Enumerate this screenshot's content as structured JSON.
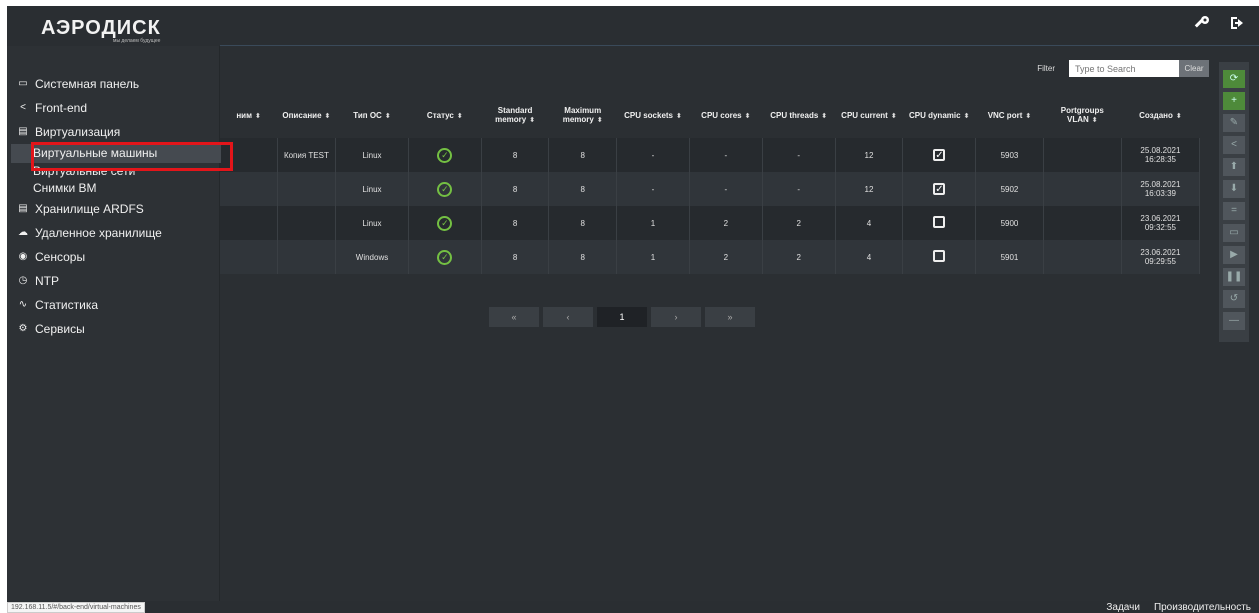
{
  "logo": {
    "text": "АЭРОДИСК",
    "sub": "мы делаем будущее"
  },
  "topbar": {
    "icons": [
      "key-icon",
      "logout-icon"
    ]
  },
  "sidebar": {
    "items": [
      {
        "label": "Системная панель",
        "icon": "monitor-icon"
      },
      {
        "label": "Front-end",
        "icon": "share-icon"
      },
      {
        "label": "Виртуализация",
        "icon": "database-icon"
      },
      {
        "label": "Виртуальные машины",
        "sub": true,
        "active": true
      },
      {
        "label": "Виртуальные сети",
        "sub": true
      },
      {
        "label": "Снимки ВМ",
        "sub": true
      },
      {
        "label": "Хранилище ARDFS",
        "icon": "database-icon"
      },
      {
        "label": "Удаленное хранилище",
        "icon": "cloud-icon"
      },
      {
        "label": "Сенсоры",
        "icon": "eye-icon"
      },
      {
        "label": "NTP",
        "icon": "clock-icon"
      },
      {
        "label": "Статистика",
        "icon": "chart-icon"
      },
      {
        "label": "Сервисы",
        "icon": "gears-icon"
      }
    ]
  },
  "filter": {
    "label": "Filter",
    "placeholder": "Type to Search",
    "clear": "Clear"
  },
  "table": {
    "headers": [
      "ним",
      "Описание",
      "Тип ОС",
      "Статус",
      "Standard memory",
      "Maximum memory",
      "CPU sockets",
      "CPU cores",
      "CPU threads",
      "CPU current",
      "CPU dynamic",
      "VNC port",
      "Portgroups VLAN",
      "Создано"
    ],
    "rows": [
      {
        "desc": "Копия TEST",
        "os": "Linux",
        "std": "8",
        "max": "8",
        "sockets": "-",
        "cores": "-",
        "threads": "-",
        "current": "12",
        "dynamic": true,
        "vnc": "5903",
        "vlan": "",
        "created_date": "25.08.2021",
        "created_time": "16:28:35"
      },
      {
        "desc": "",
        "os": "Linux",
        "std": "8",
        "max": "8",
        "sockets": "-",
        "cores": "-",
        "threads": "-",
        "current": "12",
        "dynamic": true,
        "vnc": "5902",
        "vlan": "",
        "created_date": "25.08.2021",
        "created_time": "16:03:39"
      },
      {
        "desc": "",
        "os": "Linux",
        "std": "8",
        "max": "8",
        "sockets": "1",
        "cores": "2",
        "threads": "2",
        "current": "4",
        "dynamic": false,
        "vnc": "5900",
        "vlan": "",
        "created_date": "23.06.2021",
        "created_time": "09:32:55"
      },
      {
        "desc": "",
        "os": "Windows",
        "std": "8",
        "max": "8",
        "sockets": "1",
        "cores": "2",
        "threads": "2",
        "current": "4",
        "dynamic": false,
        "vnc": "5901",
        "vlan": "",
        "created_date": "23.06.2021",
        "created_time": "09:29:55"
      }
    ]
  },
  "pager": {
    "first": "«",
    "prev": "‹",
    "current": "1",
    "next": "›",
    "last": "»"
  },
  "statusbar": {
    "url": "192.168.11.5/#/back-end/virtual-machines",
    "tasks": "Задачи",
    "performance": "Производительность"
  },
  "colors": {
    "ok": "#74c043",
    "highlight": "#e3151a",
    "background": "#2b2f33"
  }
}
